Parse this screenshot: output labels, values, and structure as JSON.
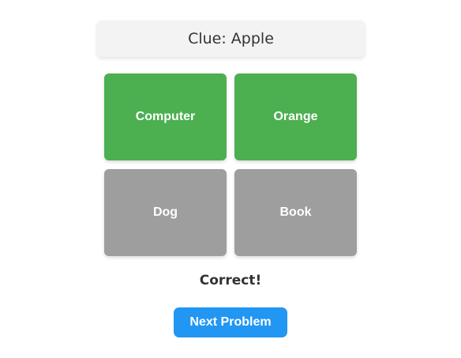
{
  "clue": {
    "text": "Clue: Apple"
  },
  "cards": [
    {
      "label": "Computer",
      "state": "selected"
    },
    {
      "label": "Orange",
      "state": "selected"
    },
    {
      "label": "Dog",
      "state": "unselected"
    },
    {
      "label": "Book",
      "state": "unselected"
    }
  ],
  "colors": {
    "selected": "#4caf50",
    "unselected": "#9e9e9e",
    "primary_button": "#2196f3"
  },
  "result": {
    "text": "Correct!"
  },
  "actions": {
    "next_label": "Next Problem"
  }
}
